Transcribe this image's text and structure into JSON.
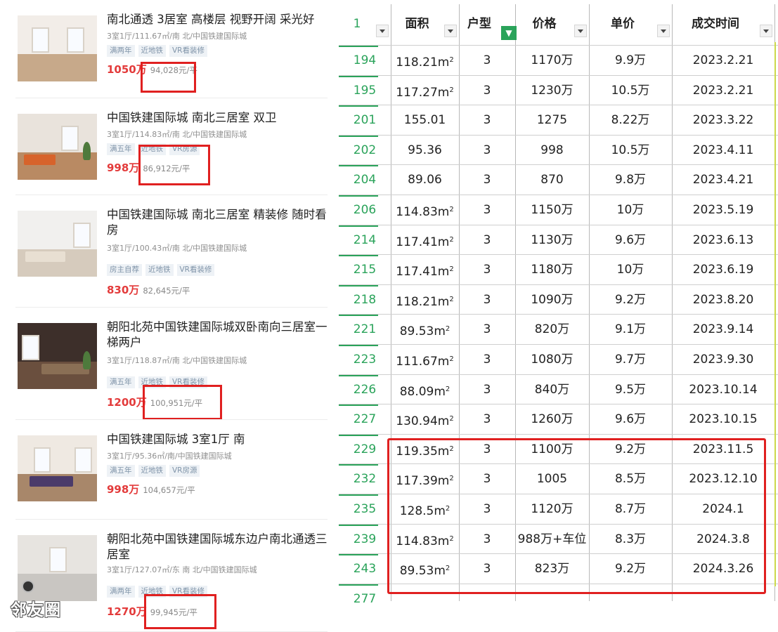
{
  "listings": [
    {
      "title": "南北通透 3居室 高楼层 视野开阔 采光好",
      "sub": "3室1厅/111.67㎡/南 北/中国铁建国际城",
      "tags": [
        "满两年",
        "近地铁",
        "VR看装修"
      ],
      "price": "1050万",
      "unit_price": "94,028元/平"
    },
    {
      "title": "中国铁建国际城 南北三居室 双卫",
      "sub": "3室1厅/114.83㎡/南 北/中国铁建国际城",
      "tags": [
        "满五年",
        "近地铁",
        "VR房源"
      ],
      "price": "998万",
      "unit_price": "86,912元/平"
    },
    {
      "title": "中国铁建国际城 南北三居室 精装修 随时看房",
      "sub": "3室1厅/100.43㎡/南 北/中国铁建国际城",
      "tags": [
        "房主自荐",
        "近地铁",
        "VR看装修"
      ],
      "price": "830万",
      "unit_price": "82,645元/平"
    },
    {
      "title": "朝阳北苑中国铁建国际城双卧南向三居室一梯两户",
      "sub": "3室1厅/118.87㎡/南 北/中国铁建国际城",
      "tags": [
        "满五年",
        "近地铁",
        "VR看装修"
      ],
      "price": "1200万",
      "unit_price": "100,951元/平"
    },
    {
      "title": "中国铁建国际城 3室1厅 南",
      "sub": "3室1厅/95.36㎡/南/中国铁建国际城",
      "tags": [
        "满五年",
        "近地铁",
        "VR房源"
      ],
      "price": "998万",
      "unit_price": "104,657元/平"
    },
    {
      "title": "朝阳北苑中国铁建国际城东边户南北通透三居室",
      "sub": "3室1厅/127.07㎡/东 南 北/中国铁建国际城",
      "tags": [
        "满两年",
        "近地铁",
        "VR看装修"
      ],
      "price": "1270万",
      "unit_price": "99,945元/平"
    }
  ],
  "watermark": "邻友圈",
  "sheet": {
    "headers": [
      "1",
      "面积",
      "户型",
      "价格",
      "单价",
      "成交时间"
    ],
    "rows": [
      {
        "rn": "194",
        "area": "118.21m",
        "sup": "2",
        "type": "3",
        "price": "1170万",
        "unit": "9.9万",
        "date": "2023.2.21"
      },
      {
        "rn": "195",
        "area": "117.27m",
        "sup": "2",
        "type": "3",
        "price": "1230万",
        "unit": "10.5万",
        "date": "2023.2.21"
      },
      {
        "rn": "201",
        "area": "155.01",
        "sup": "",
        "type": "3",
        "price": "1275",
        "unit": "8.22万",
        "date": "2023.3.22"
      },
      {
        "rn": "202",
        "area": "95.36",
        "sup": "",
        "type": "3",
        "price": "998",
        "unit": "10.5万",
        "date": "2023.4.11"
      },
      {
        "rn": "204",
        "area": "89.06",
        "sup": "",
        "type": "3",
        "price": "870",
        "unit": "9.8万",
        "date": "2023.4.21"
      },
      {
        "rn": "206",
        "area": "114.83m",
        "sup": "2",
        "type": "3",
        "price": "1150万",
        "unit": "10万",
        "date": "2023.5.19"
      },
      {
        "rn": "214",
        "area": "117.41m",
        "sup": "2",
        "type": "3",
        "price": "1130万",
        "unit": "9.6万",
        "date": "2023.6.13"
      },
      {
        "rn": "215",
        "area": "117.41m",
        "sup": "2",
        "type": "3",
        "price": "1180万",
        "unit": "10万",
        "date": "2023.6.19"
      },
      {
        "rn": "218",
        "area": "118.21m",
        "sup": "2",
        "type": "3",
        "price": "1090万",
        "unit": "9.2万",
        "date": "2023.8.20"
      },
      {
        "rn": "221",
        "area": "89.53m",
        "sup": "2",
        "type": "3",
        "price": "820万",
        "unit": "9.1万",
        "date": "2023.9.14"
      },
      {
        "rn": "223",
        "area": "111.67m",
        "sup": "2",
        "type": "3",
        "price": "1080万",
        "unit": "9.7万",
        "date": "2023.9.30"
      },
      {
        "rn": "226",
        "area": "88.09m",
        "sup": "2",
        "type": "3",
        "price": "840万",
        "unit": "9.5万",
        "date": "2023.10.14"
      },
      {
        "rn": "227",
        "area": "130.94m",
        "sup": "2",
        "type": "3",
        "price": "1260万",
        "unit": "9.6万",
        "date": "2023.10.15"
      },
      {
        "rn": "229",
        "area": "119.35m",
        "sup": "2",
        "type": "3",
        "price": "1100万",
        "unit": "9.2万",
        "date": "2023.11.5"
      },
      {
        "rn": "232",
        "area": "117.39m",
        "sup": "2",
        "type": "3",
        "price": "1005",
        "unit": "8.5万",
        "date": "2023.12.10"
      },
      {
        "rn": "235",
        "area": "128.5m",
        "sup": "2",
        "type": "3",
        "price": "1120万",
        "unit": "8.7万",
        "date": "2024.1"
      },
      {
        "rn": "239",
        "area": "114.83m",
        "sup": "2",
        "type": "3",
        "price": "988万+车位",
        "unit": "8.3万",
        "date": "2024.3.8"
      },
      {
        "rn": "243",
        "area": "89.53m",
        "sup": "2",
        "type": "3",
        "price": "823万",
        "unit": "9.2万",
        "date": "2024.3.26"
      },
      {
        "rn": "277",
        "area": "",
        "sup": "",
        "type": "",
        "price": "",
        "unit": "",
        "date": ""
      }
    ]
  },
  "colors": {
    "accent_green": "#2aa35a",
    "price_red": "#e33b3b",
    "highlight_box_red": "#e02020",
    "tag_text": "#7f93a8"
  },
  "icons": {
    "header_dropdown": "dropdown-arrow-icon",
    "active_filter": "filter-icon"
  }
}
